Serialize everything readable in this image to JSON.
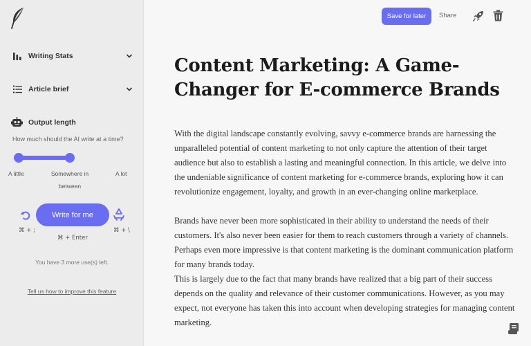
{
  "sidebar": {
    "writing_stats_label": "Writing Stats",
    "article_brief_label": "Article brief",
    "output_length_label": "Output length",
    "question": "How much should the AI write at a time?",
    "slider_labels": {
      "low": "A little",
      "mid": "Somewhere in between",
      "high": "A lot"
    },
    "slider_value": "Somewhere in between",
    "write_button": "Write for me",
    "undo_shortcut": "⌘ + ;",
    "redo_shortcut": "⌘ + \\",
    "write_shortcut": "⌘ + Enter",
    "uses_left": "You have 3 more use(s) left.",
    "improve_link": "Tell us how to improve this feature"
  },
  "header": {
    "save_label": "Save for later",
    "share_label": "Share"
  },
  "article": {
    "title": "Content Marketing: A Game-Changer for E-commerce Brands",
    "paragraphs": [
      "With the digital landscape constantly evolving, savvy e-commerce brands are harnessing the unparalleled potential of content marketing to not only capture the attention of their target audience but also to establish a lasting and meaningful connection. In this article, we delve into the undeniable significance of content marketing for e-commerce brands, exploring how it can revolutionize engagement, loyalty, and growth in an ever-changing online marketplace.",
      "Brands have never been more sophisticated in their ability to understand the needs of their customers. It's also never been easier for them to reach customers through a variety of channels. Perhaps even more impressive is that content marketing is the dominant communication platform for many brands today.",
      "This is largely due to the fact that many brands have realized that a big part of their success depends on the quality and relevance of their customer communications. However, as you may expect, not everyone has taken this into account when developing strategies for managing content marketing."
    ]
  },
  "colors": {
    "accent": "#6b6df0",
    "sidebar_bg": "#ececec",
    "page_bg": "#f7f7f7"
  },
  "icons": [
    "feather-icon",
    "bar-chart-icon",
    "list-icon",
    "chevron-down-icon",
    "robot-icon",
    "undo-icon",
    "recycle-icon",
    "rocket-icon",
    "trash-icon",
    "scroll-icon"
  ]
}
